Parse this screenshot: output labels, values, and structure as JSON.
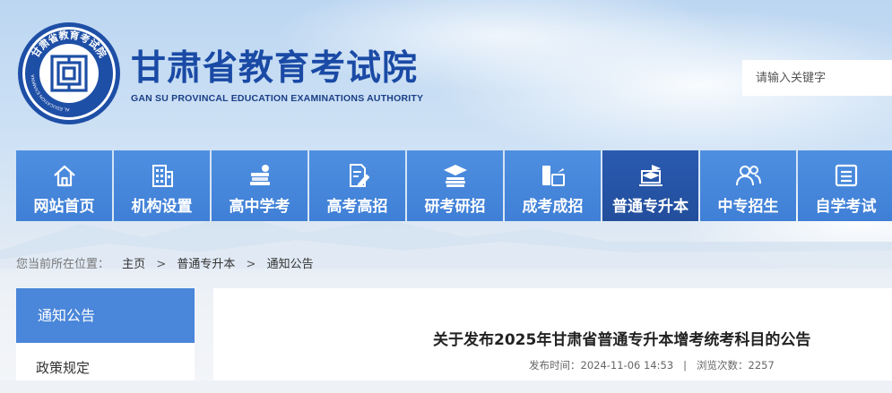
{
  "header": {
    "title": "甘肃省教育考试院",
    "subtitle": "GAN SU PROVINCAL EDUCATION EXAMINATIONS AUTHORITY",
    "logo_ring_cn": "甘肃省教育考试院",
    "logo_ring_en": "GANSU PROVINCIAL EDUCATION EXAMINATIONS AUTHORITY",
    "search_placeholder": "请输入关键字"
  },
  "nav": {
    "items": [
      {
        "label": "网站首页",
        "icon": "home-icon"
      },
      {
        "label": "机构设置",
        "icon": "building-icon"
      },
      {
        "label": "高中学考",
        "icon": "books-icon"
      },
      {
        "label": "高考高招",
        "icon": "document-pen-icon"
      },
      {
        "label": "研考研招",
        "icon": "graduation-books-icon"
      },
      {
        "label": "成考成招",
        "icon": "book-desk-icon"
      },
      {
        "label": "普通专升本",
        "icon": "laptop-cap-icon",
        "active": true
      },
      {
        "label": "中专招生",
        "icon": "users-icon"
      },
      {
        "label": "自学考试",
        "icon": "list-icon"
      }
    ]
  },
  "breadcrumb": {
    "label": "您当前所在位置：",
    "items": [
      "主页",
      "普通专升本",
      "通知公告"
    ],
    "separator": ">"
  },
  "sidebar": {
    "items": [
      "通知公告",
      "政策规定"
    ]
  },
  "article": {
    "title": "关于发布2025年甘肃省普通专升本增考统考科目的公告",
    "publish_label": "发布时间：",
    "publish_time": "2024-11-06 14:53",
    "views_label": "浏览次数：",
    "views": "2257",
    "separator": "|"
  },
  "colors": {
    "nav_blue": "#4387dd",
    "nav_active": "#2a5ab0",
    "title_blue": "#1a4aa5",
    "logo_blue": "#1e4fa6"
  }
}
